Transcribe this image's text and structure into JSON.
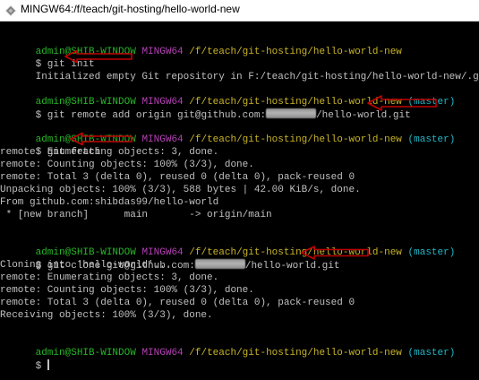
{
  "window": {
    "title": "MINGW64:/f/teach/git-hosting/hello-world-new",
    "icon": "git-bash-icon"
  },
  "terminal": {
    "colors": {
      "background": "#000000",
      "text": "#c0c0c0",
      "user": "#28b628",
      "host": "#b640b6",
      "path": "#c8b428",
      "branch": "#20b8c8",
      "annotation_arrow": "#c00000"
    },
    "prompts": [
      {
        "user": "admin@SHIB-WINDOW",
        "host": "MINGW64",
        "path": "/f/teach/git-hosting/hello-world-new",
        "branch": ""
      },
      {
        "user": "admin@SHIB-WINDOW",
        "host": "MINGW64",
        "path": "/f/teach/git-hosting/hello-world-new",
        "branch": "(master)"
      },
      {
        "user": "admin@SHIB-WINDOW",
        "host": "MINGW64",
        "path": "/f/teach/git-hosting/hello-world-new",
        "branch": "(master)"
      },
      {
        "user": "admin@SHIB-WINDOW",
        "host": "MINGW64",
        "path": "/f/teach/git-hosting/hello-world-new",
        "branch": "(master)"
      },
      {
        "user": "admin@SHIB-WINDOW",
        "host": "MINGW64",
        "path": "/f/teach/git-hosting/hello-world-new",
        "branch": "(master)"
      }
    ],
    "commands": {
      "init": "$ git init",
      "remote_prefix": "$ git remote add origin git@github.com:",
      "remote_suffix": "/hello-world.git",
      "fetch": "$ git fetch",
      "clone_prefix": "$ git clone git@github.com:",
      "clone_suffix": "/hello-world.git",
      "final": "$ "
    },
    "output": {
      "init": [
        "Initialized empty Git repository in F:/teach/git-hosting/hello-world-new/.git/"
      ],
      "fetch": [
        "remote: Enumerating objects: 3, done.",
        "remote: Counting objects: 100% (3/3), done.",
        "remote: Total 3 (delta 0), reused 0 (delta 0), pack-reused 0",
        "Unpacking objects: 100% (3/3), 588 bytes | 42.00 KiB/s, done.",
        "From github.com:shibdas99/hello-world",
        " * [new branch]      main       -> origin/main"
      ],
      "clone": [
        "Cloning into 'hello-world'...",
        "remote: Enumerating objects: 3, done.",
        "remote: Counting objects: 100% (3/3), done.",
        "remote: Total 3 (delta 0), reused 0 (delta 0), pack-reused 0",
        "Receiving objects: 100% (3/3), done."
      ]
    }
  }
}
